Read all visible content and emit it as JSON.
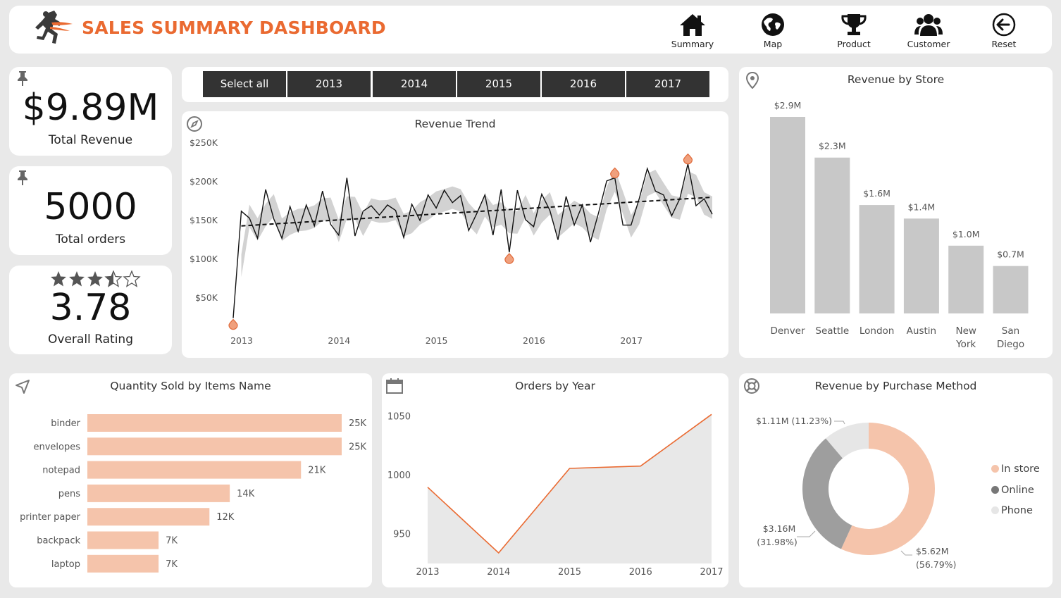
{
  "header": {
    "title": "SALES SUMMARY DASHBOARD",
    "nav": [
      {
        "label": "Summary",
        "icon": "home-icon"
      },
      {
        "label": "Map",
        "icon": "globe-icon"
      },
      {
        "label": "Product",
        "icon": "trophy-icon"
      },
      {
        "label": "Customer",
        "icon": "users-icon"
      },
      {
        "label": "Reset",
        "icon": "back-arrow-icon"
      }
    ]
  },
  "kpis": {
    "revenue": {
      "value": "$9.89M",
      "label": "Total Revenue"
    },
    "orders": {
      "value": "5000",
      "label": "Total orders"
    },
    "rating": {
      "value": "3.78",
      "label": "Overall Rating",
      "stars": 3.5,
      "max_stars": 5
    }
  },
  "slicer": {
    "buttons": [
      "Select all",
      "2013",
      "2014",
      "2015",
      "2016",
      "2017"
    ]
  },
  "colors": {
    "accent": "#ea6a31",
    "bar_gray": "#c8c8c8",
    "bar_peach": "#f5c4ab",
    "donut_gray": "#9e9e9e",
    "donut_light": "#e6e6e6",
    "slicer_bg": "#333333"
  },
  "revenue_trend": {
    "title": "Revenue Trend",
    "y_ticks": [
      "$250K",
      "$200K",
      "$150K",
      "$100K",
      "$50K"
    ],
    "x_ticks": [
      "2013",
      "2014",
      "2015",
      "2016",
      "2017"
    ]
  },
  "revenue_by_store": {
    "title": "Revenue by Store"
  },
  "quantity_by_item": {
    "title": "Quantity Sold by Items Name"
  },
  "orders_by_year": {
    "title": "Orders by Year"
  },
  "revenue_by_method": {
    "title": "Revenue by Purchase Method",
    "labels": {
      "phone": "$1.11M (11.23%)",
      "online_1": "$3.16M",
      "online_2": "(31.98%)",
      "store_1": "$5.62M",
      "store_2": "(56.79%)"
    },
    "legend": [
      "In store",
      "Online",
      "Phone"
    ]
  },
  "chart_data": [
    {
      "id": "revenue_trend",
      "type": "line",
      "title": "Revenue Trend",
      "ylim": [
        0,
        250000
      ],
      "y_tick_values": [
        50000,
        100000,
        150000,
        200000,
        250000
      ],
      "x_ticks": [
        "2013",
        "2014",
        "2015",
        "2016",
        "2017"
      ],
      "series": [
        {
          "name": "",
          "values": [
            24000,
            162000,
            153000,
            127000,
            190000,
            152000,
            127000,
            168000,
            136000,
            170000,
            143000,
            188000,
            145000,
            131000,
            205000,
            130000,
            162000,
            169000,
            157000,
            170000,
            163000,
            128000,
            171000,
            150000,
            183000,
            166000,
            189000,
            173000,
            182000,
            137000,
            159000,
            183000,
            131000,
            190000,
            109000,
            189000,
            151000,
            142000,
            184000,
            163000,
            125000,
            181000,
            144000,
            170000,
            122000,
            160000,
            201000,
            205000,
            144000,
            144000,
            178000,
            217000,
            188000,
            183000,
            156000,
            178000,
            223000,
            169000,
            178000,
            158000
          ]
        }
      ],
      "trend_line": {
        "start": 143000,
        "end": 180000
      },
      "outlier_markers": [
        0,
        34,
        47,
        56
      ]
    },
    {
      "id": "revenue_by_store",
      "type": "bar",
      "title": "Revenue by Store",
      "categories": [
        "Denver",
        "Seattle",
        "London",
        "Austin",
        "New York",
        "San Diego"
      ],
      "values": [
        2.9,
        2.3,
        1.6,
        1.4,
        1.0,
        0.7
      ],
      "value_labels": [
        "$2.9M",
        "$2.3M",
        "$1.6M",
        "$1.4M",
        "$1.0M",
        "$0.7M"
      ],
      "unit": "$M"
    },
    {
      "id": "quantity_by_item",
      "type": "bar",
      "orientation": "horizontal",
      "title": "Quantity Sold by Items Name",
      "categories": [
        "binder",
        "envelopes",
        "notepad",
        "pens",
        "printer paper",
        "backpack",
        "laptop"
      ],
      "values": [
        25,
        25,
        21,
        14,
        12,
        7,
        7
      ],
      "value_labels": [
        "25K",
        "25K",
        "21K",
        "14K",
        "12K",
        "7K",
        "7K"
      ],
      "unit": "K"
    },
    {
      "id": "orders_by_year",
      "type": "area",
      "title": "Orders by Year",
      "x": [
        "2013",
        "2014",
        "2015",
        "2016",
        "2017"
      ],
      "values": [
        990,
        934,
        1006,
        1008,
        1052
      ],
      "ylim": [
        925,
        1060
      ],
      "y_ticks": [
        "1050",
        "1000",
        "950"
      ],
      "y_tick_values": [
        1050,
        1000,
        950
      ]
    },
    {
      "id": "revenue_by_method",
      "type": "pie",
      "title": "Revenue by Purchase Method",
      "categories": [
        "In store",
        "Online",
        "Phone"
      ],
      "values": [
        5.62,
        3.16,
        1.11
      ],
      "percents": [
        56.79,
        31.98,
        11.23
      ],
      "legend_placement": "right"
    }
  ]
}
